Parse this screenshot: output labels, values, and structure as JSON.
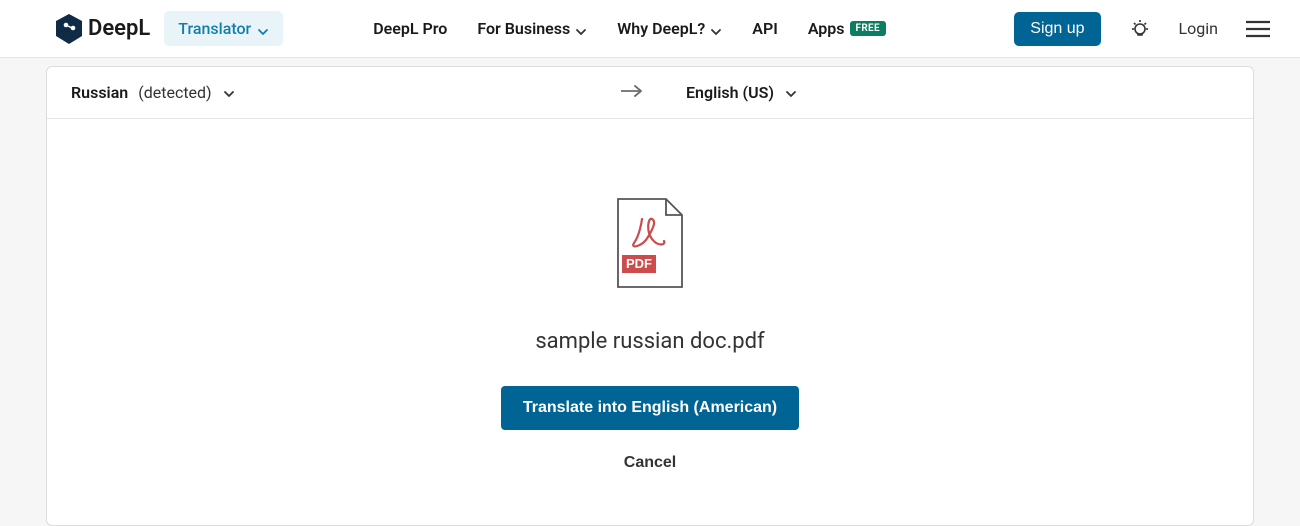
{
  "header": {
    "logo_text": "DeepL",
    "translator_label": "Translator",
    "nav": {
      "pro": "DeepL Pro",
      "business": "For Business",
      "why": "Why DeepL?",
      "api": "API",
      "apps": "Apps",
      "apps_badge": "FREE"
    },
    "signup": "Sign up",
    "login": "Login"
  },
  "lang": {
    "source_name": "Russian",
    "source_detected": "(detected)",
    "target_name": "English (US)"
  },
  "doc": {
    "file_name": "sample russian doc.pdf",
    "translate_label": "Translate into English (American)",
    "cancel_label": "Cancel",
    "pdf_badge": "PDF"
  }
}
